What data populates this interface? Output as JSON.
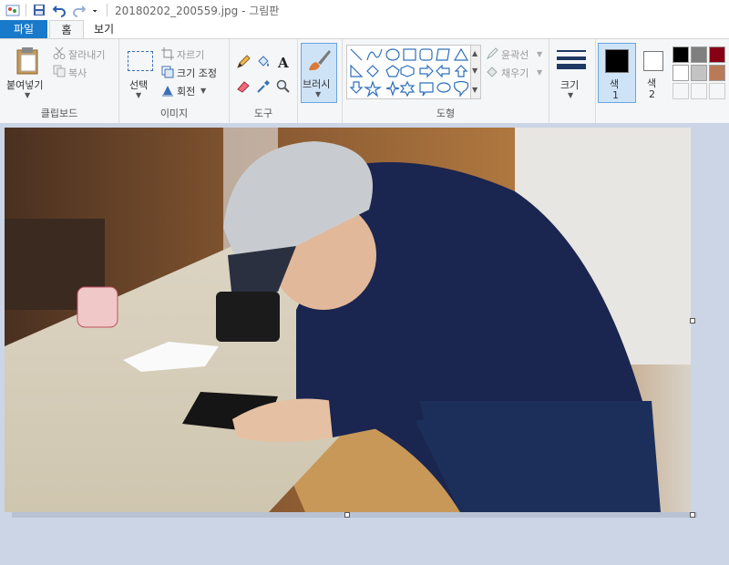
{
  "window": {
    "title": "20180202_200559.jpg - 그림판"
  },
  "tabs": {
    "file": "파일",
    "home": "홈",
    "view": "보기"
  },
  "clipboard": {
    "paste": "붙여넣기",
    "cut": "잘라내기",
    "copy": "복사",
    "label": "클립보드"
  },
  "image_group": {
    "select": "선택",
    "crop": "자르기",
    "resize": "크기 조정",
    "rotate": "회전",
    "label": "이미지"
  },
  "tools": {
    "label": "도구"
  },
  "brush": {
    "label": "브러시"
  },
  "shapes": {
    "outline": "윤곽선",
    "fill": "채우기",
    "label": "도형"
  },
  "size": {
    "label": "크기"
  },
  "colors": {
    "color1_label": "색\n1",
    "color1_l1": "색",
    "color1_l2": "1",
    "color2_l1": "색",
    "color2_l2": "2",
    "color1": "#000000",
    "color2": "#ffffff",
    "palette": [
      "#000000",
      "#7f7f7f",
      "#880015",
      "#ffffff",
      "#c3c3c3",
      "#b97a57"
    ],
    "accent": "#1979ca"
  }
}
